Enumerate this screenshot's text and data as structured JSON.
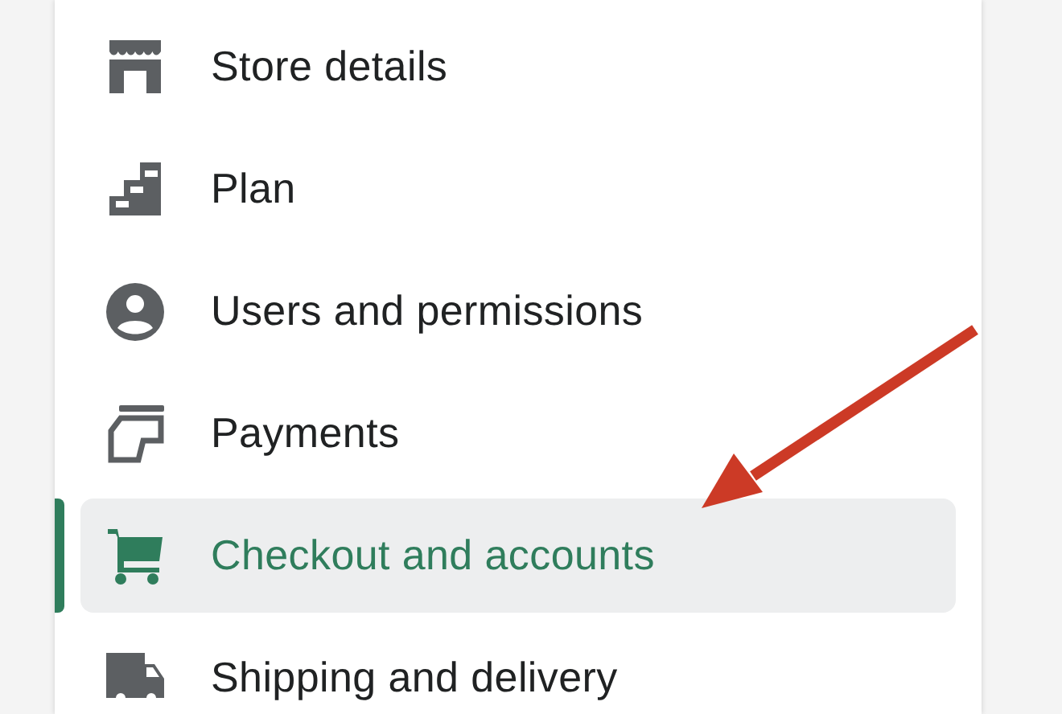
{
  "settings_menu": {
    "items": [
      {
        "label": "Store details",
        "selected": false
      },
      {
        "label": "Plan",
        "selected": false
      },
      {
        "label": "Users and permissions",
        "selected": false
      },
      {
        "label": "Payments",
        "selected": false
      },
      {
        "label": "Checkout and accounts",
        "selected": true
      },
      {
        "label": "Shipping and delivery",
        "selected": false
      }
    ]
  },
  "overlay": {
    "kind": "arrow"
  }
}
